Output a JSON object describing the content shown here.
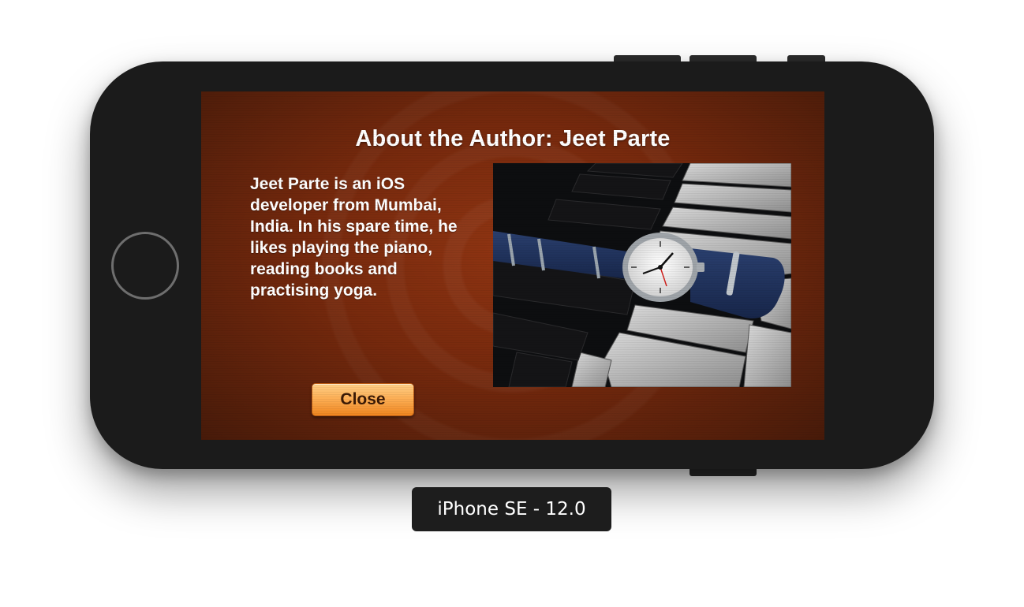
{
  "screen": {
    "title": "About the Author: Jeet Parte",
    "bio": "Jeet Parte is an iOS developer from Mumbai, India. In his spare time, he likes playing the piano, reading books and practising yoga.",
    "close_label": "Close"
  },
  "simulator": {
    "device_label": "iPhone SE - 12.0"
  },
  "colors": {
    "background_brown": "#76290d",
    "button_orange": "#fdb057",
    "device_body": "#1b1b1b"
  },
  "icons": {
    "home_button": "home-button-icon"
  }
}
